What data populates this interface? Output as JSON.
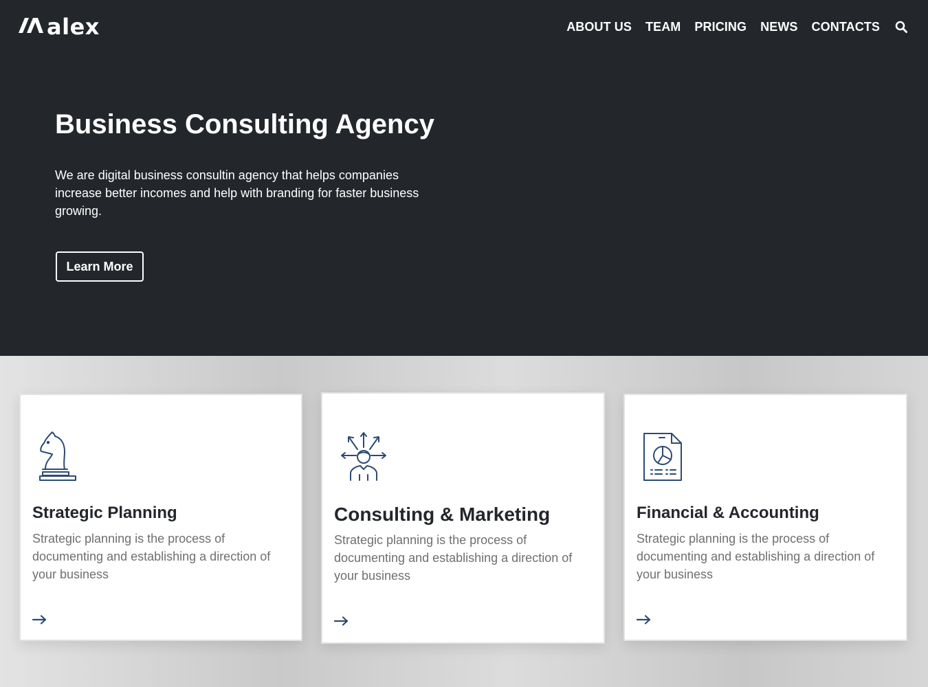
{
  "brand": {
    "logo_text": "alex"
  },
  "nav": {
    "links": [
      "ABOUT US",
      "TEAM",
      "PRICING",
      "NEWS",
      "CONTACTS"
    ],
    "search_icon": "search-icon"
  },
  "hero": {
    "title": "Business Consulting Agency",
    "description": "We are digital business consultin agency that helps companies increase better incomes and help with branding for faster business growing.",
    "cta_label": "Learn More"
  },
  "services": [
    {
      "title": "Strategic Planning",
      "text": "Strategic planning is the process of documenting and establishing a direction of your business",
      "icon": "chess-knight-icon"
    },
    {
      "title": "Consulting & Marketing",
      "text": "Strategic planning is the process of documenting and establishing a direction of your business",
      "icon": "consultant-icon"
    },
    {
      "title": "Financial & Accounting",
      "text": "Strategic planning is the process of documenting and establishing a direction of your business",
      "icon": "financial-report-icon"
    }
  ],
  "colors": {
    "hero_bg": "#23262b",
    "accent_icon": "#2b4a73",
    "card_text": "#6f6f6f"
  }
}
